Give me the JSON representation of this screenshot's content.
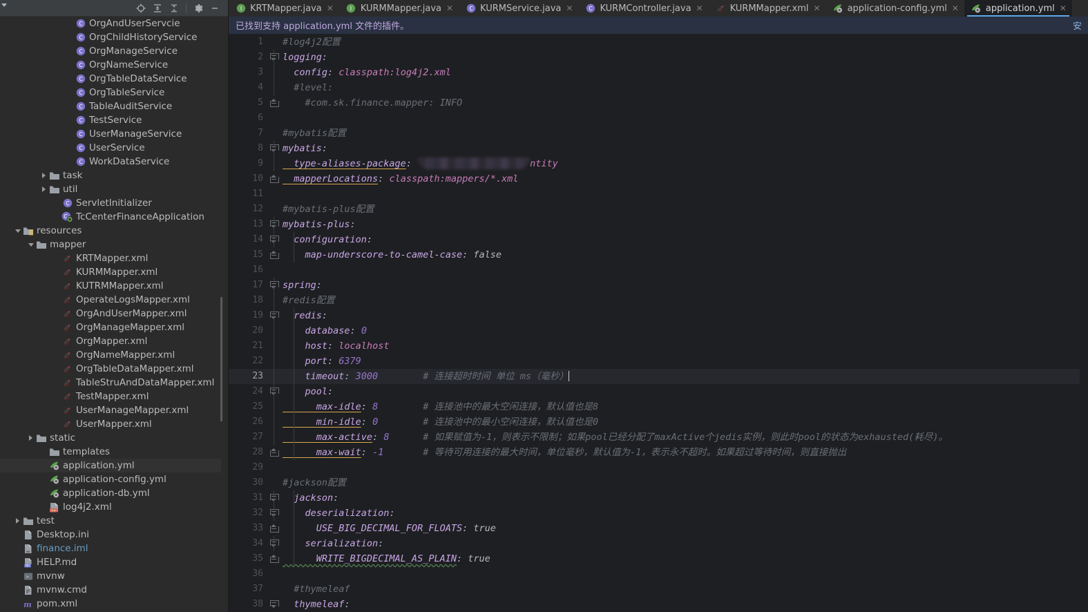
{
  "sidebar": {
    "toolbar": [
      {
        "name": "locate-icon",
        "label": "Select Opened File"
      },
      {
        "name": "expand-all-icon",
        "label": "Expand All"
      },
      {
        "name": "collapse-all-icon",
        "label": "Collapse All"
      },
      {
        "name": "settings-gear-icon",
        "label": "Options"
      },
      {
        "name": "minimize-icon",
        "label": "Hide"
      }
    ],
    "tree": [
      {
        "label": "OrgAndUserServcie",
        "icon": "class-icon",
        "indent": 5,
        "type": "class",
        "arrow": "none"
      },
      {
        "label": "OrgChildHistoryService",
        "icon": "class-icon",
        "indent": 5,
        "type": "class",
        "arrow": "none"
      },
      {
        "label": "OrgManageService",
        "icon": "class-icon",
        "indent": 5,
        "type": "class",
        "arrow": "none"
      },
      {
        "label": "OrgNameService",
        "icon": "class-icon",
        "indent": 5,
        "type": "class",
        "arrow": "none"
      },
      {
        "label": "OrgTableDataService",
        "icon": "class-icon",
        "indent": 5,
        "type": "class",
        "arrow": "none"
      },
      {
        "label": "OrgTableService",
        "icon": "class-icon",
        "indent": 5,
        "type": "class",
        "arrow": "none"
      },
      {
        "label": "TableAuditService",
        "icon": "class-icon",
        "indent": 5,
        "type": "class",
        "arrow": "none"
      },
      {
        "label": "TestService",
        "icon": "class-icon",
        "indent": 5,
        "type": "class",
        "arrow": "none"
      },
      {
        "label": "UserManageService",
        "icon": "class-icon",
        "indent": 5,
        "type": "class",
        "arrow": "none"
      },
      {
        "label": "UserService",
        "icon": "class-icon",
        "indent": 5,
        "type": "class",
        "arrow": "none"
      },
      {
        "label": "WorkDataService",
        "icon": "class-icon",
        "indent": 5,
        "type": "class",
        "arrow": "none"
      },
      {
        "label": "task",
        "icon": "folder-icon",
        "indent": 3,
        "type": "folder",
        "arrow": "closed"
      },
      {
        "label": "util",
        "icon": "folder-icon",
        "indent": 3,
        "type": "folder",
        "arrow": "closed"
      },
      {
        "label": "ServletInitializer",
        "icon": "class-icon",
        "indent": 4,
        "type": "class",
        "arrow": "none"
      },
      {
        "label": "TcCenterFinanceApplication",
        "icon": "spring-boot-class-icon",
        "indent": 4,
        "type": "boot",
        "arrow": "none"
      },
      {
        "label": "resources",
        "icon": "resources-folder-icon",
        "indent": 1,
        "type": "resfolder",
        "arrow": "open"
      },
      {
        "label": "mapper",
        "icon": "folder-icon",
        "indent": 2,
        "type": "folder",
        "arrow": "open"
      },
      {
        "label": "KRTMapper.xml",
        "icon": "mybatis-xml-icon",
        "indent": 4,
        "type": "mybatis",
        "arrow": "none"
      },
      {
        "label": "KURMMapper.xml",
        "icon": "mybatis-xml-icon",
        "indent": 4,
        "type": "mybatis",
        "arrow": "none"
      },
      {
        "label": "KUTRMMapper.xml",
        "icon": "mybatis-xml-icon",
        "indent": 4,
        "type": "mybatis",
        "arrow": "none"
      },
      {
        "label": "OperateLogsMapper.xml",
        "icon": "mybatis-xml-icon",
        "indent": 4,
        "type": "mybatis",
        "arrow": "none"
      },
      {
        "label": "OrgAndUserMapper.xml",
        "icon": "mybatis-xml-icon",
        "indent": 4,
        "type": "mybatis",
        "arrow": "none"
      },
      {
        "label": "OrgManageMapper.xml",
        "icon": "mybatis-xml-icon",
        "indent": 4,
        "type": "mybatis",
        "arrow": "none"
      },
      {
        "label": "OrgMapper.xml",
        "icon": "mybatis-xml-icon",
        "indent": 4,
        "type": "mybatis",
        "arrow": "none"
      },
      {
        "label": "OrgNameMapper.xml",
        "icon": "mybatis-xml-icon",
        "indent": 4,
        "type": "mybatis",
        "arrow": "none"
      },
      {
        "label": "OrgTableDataMapper.xml",
        "icon": "mybatis-xml-icon",
        "indent": 4,
        "type": "mybatis",
        "arrow": "none"
      },
      {
        "label": "TableStruAndDataMapper.xml",
        "icon": "mybatis-xml-icon",
        "indent": 4,
        "type": "mybatis",
        "arrow": "none"
      },
      {
        "label": "TestMapper.xml",
        "icon": "mybatis-xml-icon",
        "indent": 4,
        "type": "mybatis",
        "arrow": "none"
      },
      {
        "label": "UserManageMapper.xml",
        "icon": "mybatis-xml-icon",
        "indent": 4,
        "type": "mybatis",
        "arrow": "none"
      },
      {
        "label": "UserMapper.xml",
        "icon": "mybatis-xml-icon",
        "indent": 4,
        "type": "mybatis",
        "arrow": "none"
      },
      {
        "label": "static",
        "icon": "folder-icon",
        "indent": 2,
        "type": "folder",
        "arrow": "closed"
      },
      {
        "label": "templates",
        "icon": "folder-icon",
        "indent": 3,
        "type": "folder",
        "arrow": "none"
      },
      {
        "label": "application.yml",
        "icon": "yaml-icon",
        "indent": 3,
        "type": "yaml",
        "arrow": "none",
        "selected": true
      },
      {
        "label": "application-config.yml",
        "icon": "yaml-icon",
        "indent": 3,
        "type": "yaml",
        "arrow": "none"
      },
      {
        "label": "application-db.yml",
        "icon": "yaml-icon",
        "indent": 3,
        "type": "yaml",
        "arrow": "none"
      },
      {
        "label": "log4j2.xml",
        "icon": "xml-icon",
        "indent": 3,
        "type": "xml",
        "arrow": "none"
      },
      {
        "label": "test",
        "icon": "folder-icon",
        "indent": 1,
        "type": "folder",
        "arrow": "closed"
      },
      {
        "label": "Desktop.ini",
        "icon": "ini-file-icon",
        "indent": 1,
        "type": "ini",
        "arrow": "none"
      },
      {
        "label": "finance.iml",
        "icon": "iml-file-icon",
        "indent": 1,
        "type": "iml",
        "arrow": "none",
        "color": "#6a9ec5"
      },
      {
        "label": "HELP.md",
        "icon": "markdown-file-icon",
        "indent": 1,
        "type": "md",
        "arrow": "none"
      },
      {
        "label": "mvnw",
        "icon": "shell-script-icon",
        "indent": 1,
        "type": "sh",
        "arrow": "none"
      },
      {
        "label": "mvnw.cmd",
        "icon": "cmd-script-icon",
        "indent": 1,
        "type": "cmd",
        "arrow": "none"
      },
      {
        "label": "pom.xml",
        "icon": "maven-pom-icon",
        "indent": 1,
        "type": "pom",
        "arrow": "none"
      }
    ]
  },
  "tabs": [
    {
      "label": "KRTMapper.java",
      "icon": "interface-icon",
      "active": false
    },
    {
      "label": "KURMMapper.java",
      "icon": "interface-icon",
      "active": false
    },
    {
      "label": "KURMService.java",
      "icon": "class-icon",
      "active": false
    },
    {
      "label": "KURMController.java",
      "icon": "class-icon",
      "active": false
    },
    {
      "label": "KURMMapper.xml",
      "icon": "mybatis-xml-icon",
      "active": false
    },
    {
      "label": "application-config.yml",
      "icon": "yaml-icon",
      "active": false
    },
    {
      "label": "application.yml",
      "icon": "yaml-icon",
      "active": true
    }
  ],
  "notification": {
    "message": "已找到支持 application.yml 文件的插件。",
    "action": "安"
  },
  "editor": {
    "current_line": 23,
    "total_visible_lines": 38,
    "lines": [
      {
        "n": 1,
        "tokens": [
          {
            "t": "#log4j2配置",
            "c": "cm"
          }
        ],
        "indent": 0
      },
      {
        "n": 2,
        "tokens": [
          {
            "t": "logging",
            "c": "k"
          },
          {
            "t": ":",
            "c": "pn"
          }
        ],
        "indent": 0,
        "fold": "top"
      },
      {
        "n": 3,
        "tokens": [
          {
            "t": "  config",
            "c": "k"
          },
          {
            "t": ": ",
            "c": "pn"
          },
          {
            "t": "classpath:log4j2.xml",
            "c": "str"
          }
        ],
        "indent": 1
      },
      {
        "n": 4,
        "tokens": [
          {
            "t": "  #level:",
            "c": "cm"
          }
        ],
        "indent": 1
      },
      {
        "n": 5,
        "tokens": [
          {
            "t": "    #com.sk.finance.mapper: INFO",
            "c": "cm"
          }
        ],
        "indent": 2,
        "fold": "bot"
      },
      {
        "n": 6,
        "tokens": [],
        "indent": 0
      },
      {
        "n": 7,
        "tokens": [
          {
            "t": "#mybatis配置",
            "c": "cm"
          }
        ],
        "indent": 0
      },
      {
        "n": 8,
        "tokens": [
          {
            "t": "mybatis",
            "c": "k"
          },
          {
            "t": ":",
            "c": "pn"
          }
        ],
        "indent": 0,
        "fold": "top"
      },
      {
        "n": 9,
        "tokens": [
          {
            "t": "  type-aliases-package",
            "c": "kp"
          },
          {
            "t": ": ",
            "c": "pn"
          },
          {
            "t": "__REDACT__",
            "c": "redact"
          },
          {
            "t": "ntity",
            "c": "str"
          }
        ],
        "indent": 1
      },
      {
        "n": 10,
        "tokens": [
          {
            "t": "  mapperLocations",
            "c": "kp"
          },
          {
            "t": ": ",
            "c": "pn"
          },
          {
            "t": "classpath:mappers/*.xml",
            "c": "str"
          }
        ],
        "indent": 1,
        "fold": "bot"
      },
      {
        "n": 11,
        "tokens": [],
        "indent": 0
      },
      {
        "n": 12,
        "tokens": [
          {
            "t": "#mybatis-plus配置",
            "c": "cm"
          }
        ],
        "indent": 0
      },
      {
        "n": 13,
        "tokens": [
          {
            "t": "mybatis-plus",
            "c": "k"
          },
          {
            "t": ":",
            "c": "pn"
          }
        ],
        "indent": 0,
        "fold": "top"
      },
      {
        "n": 14,
        "tokens": [
          {
            "t": "  configuration",
            "c": "k"
          },
          {
            "t": ":",
            "c": "pn"
          }
        ],
        "indent": 1,
        "fold": "top"
      },
      {
        "n": 15,
        "tokens": [
          {
            "t": "    map-underscore-to-camel-case",
            "c": "k"
          },
          {
            "t": ": ",
            "c": "pn"
          },
          {
            "t": "false",
            "c": "bool"
          }
        ],
        "indent": 2,
        "fold": "bot"
      },
      {
        "n": 16,
        "tokens": [],
        "indent": 0
      },
      {
        "n": 17,
        "tokens": [
          {
            "t": "spring",
            "c": "k"
          },
          {
            "t": ":",
            "c": "pn"
          }
        ],
        "indent": 0,
        "fold": "top"
      },
      {
        "n": 18,
        "tokens": [
          {
            "t": "#redis配置",
            "c": "cm"
          }
        ],
        "indent": 0
      },
      {
        "n": 19,
        "tokens": [
          {
            "t": "  redis",
            "c": "k"
          },
          {
            "t": ":",
            "c": "pn"
          }
        ],
        "indent": 1,
        "fold": "top"
      },
      {
        "n": 20,
        "tokens": [
          {
            "t": "    database",
            "c": "k"
          },
          {
            "t": ": ",
            "c": "pn"
          },
          {
            "t": "0",
            "c": "num"
          }
        ],
        "indent": 2
      },
      {
        "n": 21,
        "tokens": [
          {
            "t": "    host",
            "c": "k"
          },
          {
            "t": ": ",
            "c": "pn"
          },
          {
            "t": "localhost",
            "c": "loc"
          }
        ],
        "indent": 2
      },
      {
        "n": 22,
        "tokens": [
          {
            "t": "    port",
            "c": "k"
          },
          {
            "t": ": ",
            "c": "pn"
          },
          {
            "t": "6379",
            "c": "num"
          }
        ],
        "indent": 2
      },
      {
        "n": 23,
        "tokens": [
          {
            "t": "    timeout",
            "c": "k"
          },
          {
            "t": ": ",
            "c": "pn"
          },
          {
            "t": "3000",
            "c": "num"
          },
          {
            "t": "        # 连接超时时间 单位 ms（毫秒）",
            "c": "cm"
          },
          {
            "t": "__CARET__",
            "c": "caret"
          }
        ],
        "indent": 2,
        "current": true
      },
      {
        "n": 24,
        "tokens": [
          {
            "t": "    pool",
            "c": "k"
          },
          {
            "t": ":",
            "c": "pn"
          }
        ],
        "indent": 2,
        "fold": "top"
      },
      {
        "n": 25,
        "tokens": [
          {
            "t": "      max-idle",
            "c": "kp"
          },
          {
            "t": ": ",
            "c": "pn"
          },
          {
            "t": "8",
            "c": "num"
          },
          {
            "t": "        # 连接池中的最大空闲连接，默认值也是8",
            "c": "cm"
          }
        ],
        "indent": 3
      },
      {
        "n": 26,
        "tokens": [
          {
            "t": "      min-idle",
            "c": "kp"
          },
          {
            "t": ": ",
            "c": "pn"
          },
          {
            "t": "0",
            "c": "num"
          },
          {
            "t": "        # 连接池中的最小空闲连接，默认值也是0",
            "c": "cm"
          }
        ],
        "indent": 3
      },
      {
        "n": 27,
        "tokens": [
          {
            "t": "      max-active",
            "c": "kp"
          },
          {
            "t": ": ",
            "c": "pn"
          },
          {
            "t": "8",
            "c": "num"
          },
          {
            "t": "      # 如果赋值为-1，则表示不限制；如果pool已经分配了maxActive个jedis实例，则此时pool的状态为exhausted(耗尽)。",
            "c": "cm"
          }
        ],
        "indent": 3
      },
      {
        "n": 28,
        "tokens": [
          {
            "t": "      max-wait",
            "c": "kp"
          },
          {
            "t": ": ",
            "c": "pn"
          },
          {
            "t": "-1",
            "c": "num"
          },
          {
            "t": "       # 等待可用连接的最大时间，单位毫秒，默认值为-1，表示永不超时。如果超过等待时间，则直接抛出",
            "c": "cm"
          }
        ],
        "indent": 3,
        "fold": "bot"
      },
      {
        "n": 29,
        "tokens": [],
        "indent": 0
      },
      {
        "n": 30,
        "tokens": [
          {
            "t": "#jackson配置",
            "c": "cm"
          }
        ],
        "indent": 0
      },
      {
        "n": 31,
        "tokens": [
          {
            "t": "  jackson",
            "c": "k"
          },
          {
            "t": ":",
            "c": "pn"
          }
        ],
        "indent": 1,
        "fold": "top"
      },
      {
        "n": 32,
        "tokens": [
          {
            "t": "    deserialization",
            "c": "k"
          },
          {
            "t": ":",
            "c": "pn"
          }
        ],
        "indent": 2,
        "fold": "top"
      },
      {
        "n": 33,
        "tokens": [
          {
            "t": "      USE_BIG_DECIMAL_FOR_FLOATS",
            "c": "k"
          },
          {
            "t": ": ",
            "c": "pn"
          },
          {
            "t": "true",
            "c": "bool"
          }
        ],
        "indent": 3,
        "fold": "bot"
      },
      {
        "n": 34,
        "tokens": [
          {
            "t": "    serialization",
            "c": "k"
          },
          {
            "t": ":",
            "c": "pn"
          }
        ],
        "indent": 2,
        "fold": "top"
      },
      {
        "n": 35,
        "tokens": [
          {
            "t": "      WRITE_BIGDECIMAL_AS_PLAIN",
            "c": "k squig"
          },
          {
            "t": ": ",
            "c": "pn"
          },
          {
            "t": "true",
            "c": "bool"
          }
        ],
        "indent": 3,
        "fold": "bot"
      },
      {
        "n": 36,
        "tokens": [],
        "indent": 0
      },
      {
        "n": 37,
        "tokens": [
          {
            "t": "  #thymeleaf",
            "c": "cm"
          }
        ],
        "indent": 1
      },
      {
        "n": 38,
        "tokens": [
          {
            "t": "  thymeleaf",
            "c": "k"
          },
          {
            "t": ":",
            "c": "pn"
          }
        ],
        "indent": 1,
        "fold": "top"
      }
    ]
  },
  "colors": {
    "sidebar_bg": "#2b2b2b",
    "editor_bg": "#1e1f22",
    "tabbar_bg": "#2b2b2b",
    "active_tab_underline": "#5fa8e8",
    "notification_bg": "#293143",
    "notification_text": "#c0a8dc",
    "current_line_bg": "#26282e",
    "selection_bg": "#323232",
    "key_color": "#c9a7e8",
    "string_color": "#c77dbb",
    "number_color": "#9876cf",
    "comment_color": "#6a6f75",
    "key_underline": "#d9a84e"
  }
}
